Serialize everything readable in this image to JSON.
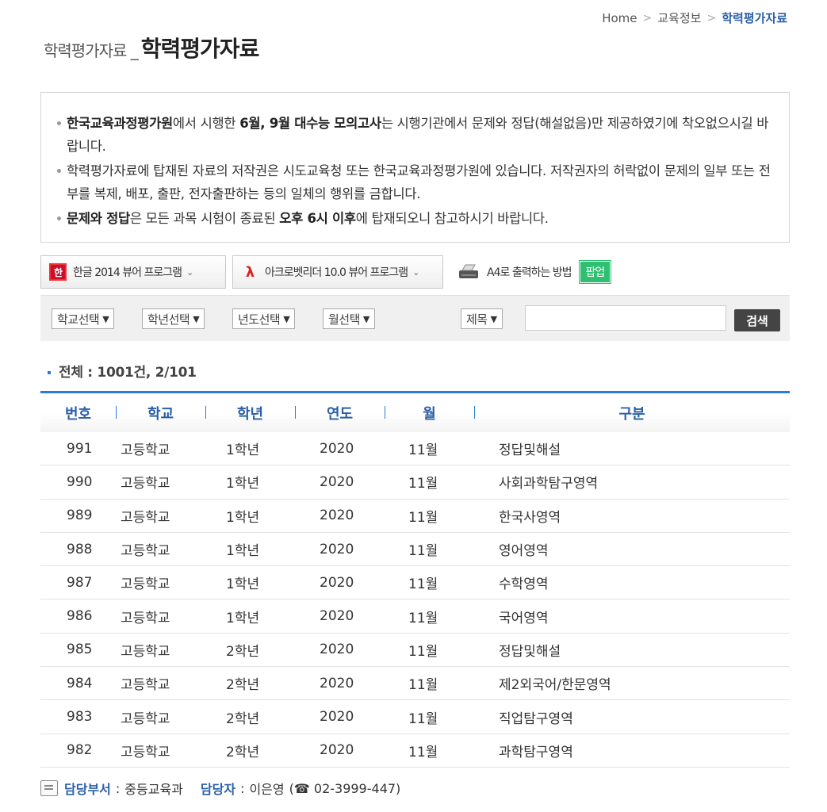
{
  "breadcrumb": {
    "home": "Home",
    "parent": "교육정보",
    "current": "학력평가자료"
  },
  "title": {
    "sub": "학력평가자료 _",
    "main": "학력평가자료"
  },
  "notice": {
    "p1": {
      "b1": "한국교육과정평가원",
      "t1": "에서 시행한 ",
      "b2": "6월, 9월 대수능 모의고사",
      "t2": "는 시행기관에서 문제와 정답(해설없음)만 제공하였기에 착오없으시길 바랍니다."
    },
    "p2": "학력평가자료에 탑재된 자료의 저작권은 시도교육청 또는 한국교육과정평가원에 있습니다. 저작권자의 허락없이 문제의 일부 또는 전부를 복제, 배포, 출판, 전자출판하는 등의 일체의 행위를 금합니다.",
    "p3": {
      "b1": "문제와 정답",
      "t1": "은 모든 과목 시험이 종료된 ",
      "b2": "오후 6시 이후",
      "t2": "에 탑재되오니 참고하시기 바랍니다."
    }
  },
  "tools": {
    "hwp_label": "한글 2014 뷰어 프로그램",
    "pdf_label": "아크로벳리더 10.0 뷰어 프로그램",
    "print_label": "A4로 출력하는 방법",
    "popup_label": "팝업"
  },
  "filters": {
    "school": "학교선택",
    "grade": "학년선택",
    "year": "년도선택",
    "month": "월선택",
    "field": "제목",
    "search_value": "",
    "search_button": "검색"
  },
  "total": "전체 : 1001건, 2/101",
  "table": {
    "headers": [
      "번호",
      "학교",
      "학년",
      "연도",
      "월",
      "구분"
    ],
    "rows": [
      [
        "991",
        "고등학교",
        "1학년",
        "2020",
        "11월",
        "정답및해설"
      ],
      [
        "990",
        "고등학교",
        "1학년",
        "2020",
        "11월",
        "사회과학탐구영역"
      ],
      [
        "989",
        "고등학교",
        "1학년",
        "2020",
        "11월",
        "한국사영역"
      ],
      [
        "988",
        "고등학교",
        "1학년",
        "2020",
        "11월",
        "영어영역"
      ],
      [
        "987",
        "고등학교",
        "1학년",
        "2020",
        "11월",
        "수학영역"
      ],
      [
        "986",
        "고등학교",
        "1학년",
        "2020",
        "11월",
        "국어영역"
      ],
      [
        "985",
        "고등학교",
        "2학년",
        "2020",
        "11월",
        "정답및해설"
      ],
      [
        "984",
        "고등학교",
        "2학년",
        "2020",
        "11월",
        "제2외국어/한문영역"
      ],
      [
        "983",
        "고등학교",
        "2학년",
        "2020",
        "11월",
        "직업탐구영역"
      ],
      [
        "982",
        "고등학교",
        "2학년",
        "2020",
        "11월",
        "과학탐구영역"
      ]
    ]
  },
  "footer": {
    "dept_label": "담당부서",
    "dept_value": "중등교육과",
    "person_label": "담당자",
    "person_value": "이은영",
    "phone": "(☎ 02-3999-447)"
  },
  "colors": {
    "accent": "#2b7bd6",
    "title_blue": "#2b5fa6",
    "popup_green": "#2fbf71",
    "search_btn": "#444444"
  }
}
